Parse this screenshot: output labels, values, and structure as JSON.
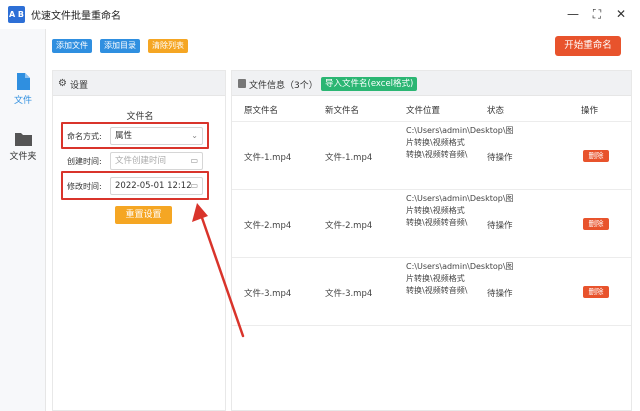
{
  "window": {
    "title": "优速文件批量重命名",
    "icon_text": "A B"
  },
  "window_controls": {
    "minimize": "—",
    "maximize": "⛶",
    "close": "✕"
  },
  "sidebar": {
    "items": [
      {
        "label": "文件",
        "icon": "file-icon",
        "active": true
      },
      {
        "label": "文件夹",
        "icon": "folder-icon",
        "active": false
      }
    ]
  },
  "toolbar": {
    "add_file": "添加文件",
    "add_dir": "添加目录",
    "clear_list": "清除列表",
    "start": "开始重命名"
  },
  "settings_panel": {
    "title": "设置",
    "section": "文件名",
    "naming_mode_label": "命名方式:",
    "naming_mode_value": "属性",
    "created_label": "创建时间:",
    "created_placeholder": "文件创建时间",
    "modified_label": "修改时间:",
    "modified_value": "2022-05-01 12:12",
    "reset": "重置设置"
  },
  "file_panel": {
    "title": "文件信息（3个）",
    "import_btn": "导入文件名(excel格式)",
    "columns": [
      "原文件名",
      "新文件名",
      "文件位置",
      "状态",
      "操作"
    ],
    "rows": [
      {
        "orig": "文件-1.mp4",
        "new": "文件-1.mp4",
        "path": "C:\\Users\\admin\\Desktop\\图片转换\\视频格式转换\\视频转音频\\",
        "status": "待操作",
        "action": "删除"
      },
      {
        "orig": "文件-2.mp4",
        "new": "文件-2.mp4",
        "path": "C:\\Users\\admin\\Desktop\\图片转换\\视频格式转换\\视频转音频\\",
        "status": "待操作",
        "action": "删除"
      },
      {
        "orig": "文件-3.mp4",
        "new": "文件-3.mp4",
        "path": "C:\\Users\\admin\\Desktop\\图片转换\\视频格式转换\\视频转音频\\",
        "status": "待操作",
        "action": "删除"
      }
    ]
  },
  "colors": {
    "add_btn": "#2f8fe0",
    "clear_btn": "#f5a623",
    "start_btn": "#e8532c",
    "import_btn": "#2bb673",
    "highlight": "#d9342b"
  }
}
